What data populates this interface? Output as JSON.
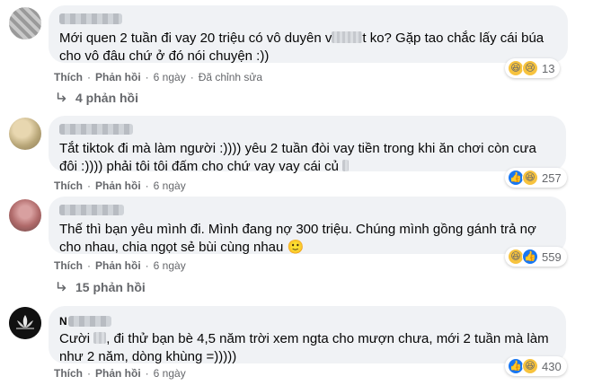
{
  "comments": [
    {
      "text_before": "Mới quen 2 tuần đi vay 20 triệu có vô duyên v",
      "text_after": "t ko? Gặp tao chắc lấy cái búa cho vô đâu chứ ở đó nói chuyện :))",
      "reaction_count": "13",
      "reactions": [
        "haha-icon",
        "sad-icon"
      ],
      "like": "Thích",
      "reply": "Phản hồi",
      "time": "6 ngày",
      "edited": "Đã chỉnh sửa",
      "replies_label": "4 phản hồi"
    },
    {
      "text": "Tắt tiktok đi mà làm người :)))) yêu 2 tuần đòi vay tiền trong khi ăn chơi còn cưa đôi :)))) phải tôi tôi đấm cho chứ vay vay cái củ",
      "reaction_count": "257",
      "reactions": [
        "like-icon",
        "haha-icon"
      ],
      "like": "Thích",
      "reply": "Phản hồi",
      "time": "6 ngày"
    },
    {
      "text": "Thế thì bạn yêu mình đi. Mình đang nợ 300 triệu. Chúng mình gồng gánh trả nợ cho nhau, chia ngọt sẻ bùi cùng nhau 🙂",
      "reaction_count": "559",
      "reactions": [
        "haha-icon",
        "like-icon"
      ],
      "like": "Thích",
      "reply": "Phản hồi",
      "time": "6 ngày",
      "replies_label": "15 phản hồi"
    },
    {
      "author": "N",
      "text_before": "Cười ",
      "text_after": ", đi thử bạn bè 4,5 năm trời xem ngta cho mượn chưa, mới 2 tuần mà làm như 2 năm, dòng khùng =)))))",
      "reaction_count": "430",
      "reactions": [
        "like-icon",
        "haha-icon"
      ],
      "like": "Thích",
      "reply": "Phản hồi",
      "time": "6 ngày"
    }
  ],
  "colors": {
    "bubble": "#f0f2f5",
    "meta": "#65676b",
    "like_blue": "#1877f2",
    "haha_yellow": "#f7c33e"
  }
}
